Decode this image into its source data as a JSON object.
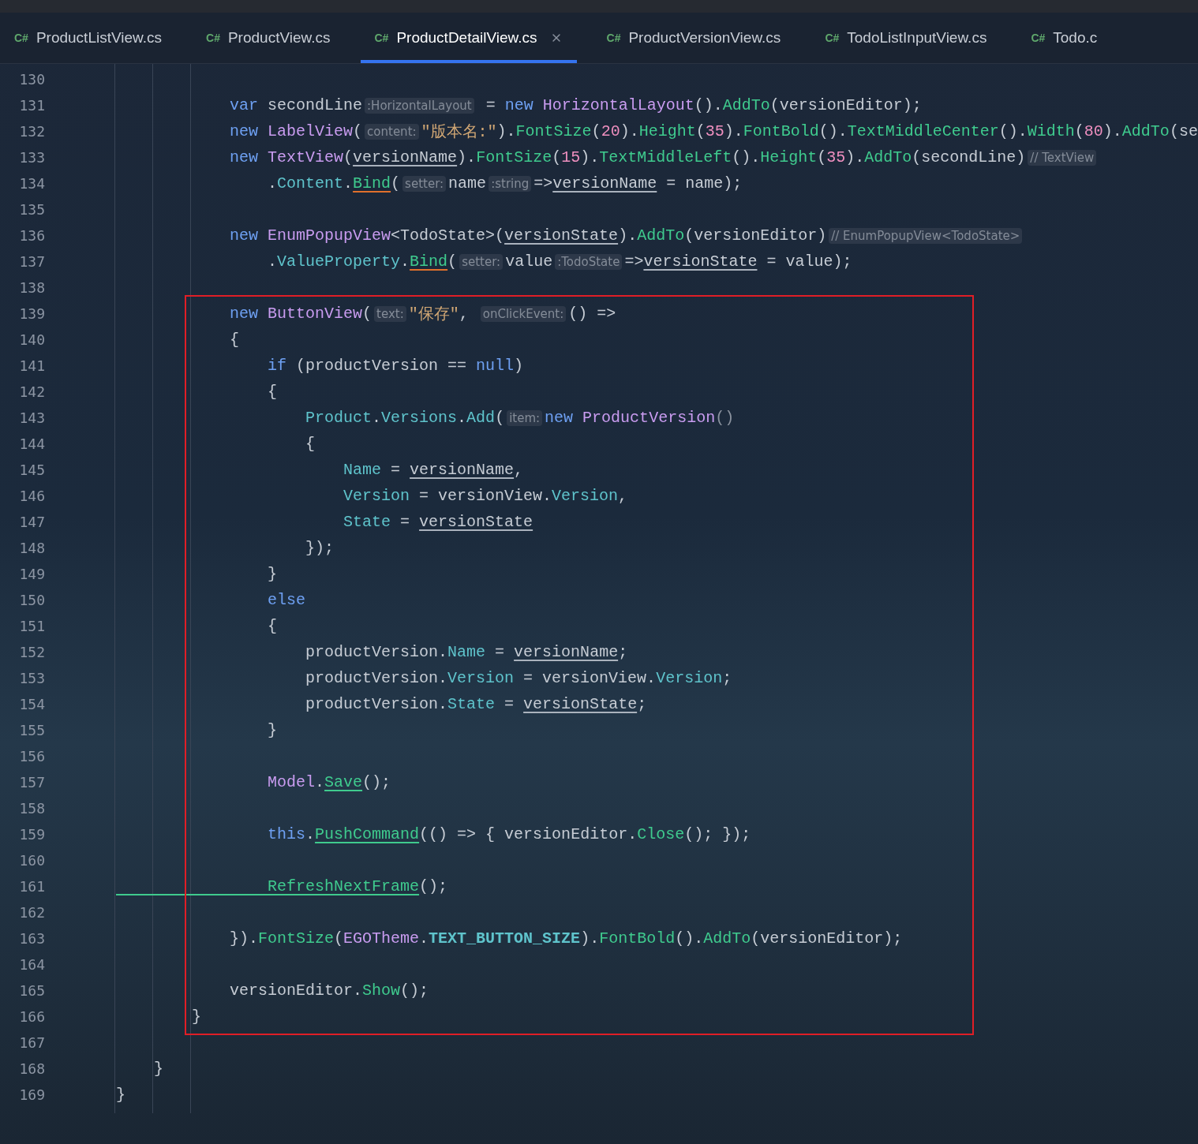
{
  "tabs": [
    {
      "badge": "C#",
      "label": "ProductListView.cs",
      "selected": false
    },
    {
      "badge": "C#",
      "label": "ProductView.cs",
      "selected": false
    },
    {
      "badge": "C#",
      "label": "ProductDetailView.cs",
      "selected": true
    },
    {
      "badge": "C#",
      "label": "ProductVersionView.cs",
      "selected": false
    },
    {
      "badge": "C#",
      "label": "TodoListInputView.cs",
      "selected": false
    },
    {
      "badge": "C#",
      "label": "Todo.c",
      "selected": false
    }
  ],
  "editor": {
    "lines": [
      {
        "n": "130",
        "highlighted": false
      },
      {
        "n": "131",
        "highlighted": false,
        "tokens": [
          {
            "kind": "kw",
            "text": "            var"
          },
          {
            "kind": "plain",
            "text": " secondLine"
          },
          {
            "kind": "hint",
            "text": ":HorizontalLayout"
          },
          {
            "kind": "plain",
            "text": " = "
          },
          {
            "kind": "kw",
            "text": "new"
          },
          {
            "kind": "type",
            "text": " HorizontalLayout"
          },
          {
            "kind": "plain",
            "text": "()."
          },
          {
            "kind": "method",
            "text": "AddTo"
          },
          {
            "kind": "plain",
            "text": "(versionEditor);"
          }
        ]
      },
      {
        "n": "132",
        "highlighted": false,
        "tokens": [
          {
            "kind": "kw",
            "text": "            new"
          },
          {
            "kind": "type",
            "text": " LabelView"
          },
          {
            "kind": "plain",
            "text": "("
          },
          {
            "kind": "hint",
            "text": "content:"
          },
          {
            "kind": "str",
            "text": "\"版本名:\""
          },
          {
            "kind": "plain",
            "text": ")."
          },
          {
            "kind": "method",
            "text": "FontSize"
          },
          {
            "kind": "plain",
            "text": "("
          },
          {
            "kind": "num",
            "text": "20"
          },
          {
            "kind": "plain",
            "text": ")."
          },
          {
            "kind": "method",
            "text": "Height"
          },
          {
            "kind": "plain",
            "text": "("
          },
          {
            "kind": "num",
            "text": "35"
          },
          {
            "kind": "plain",
            "text": ")."
          },
          {
            "kind": "method",
            "text": "FontBold"
          },
          {
            "kind": "plain",
            "text": "()."
          },
          {
            "kind": "method",
            "text": "TextMiddleCenter"
          },
          {
            "kind": "plain",
            "text": "()."
          },
          {
            "kind": "method",
            "text": "Width"
          },
          {
            "kind": "plain",
            "text": "("
          },
          {
            "kind": "num",
            "text": "80"
          },
          {
            "kind": "plain",
            "text": ")."
          },
          {
            "kind": "method",
            "text": "AddTo"
          },
          {
            "kind": "plain",
            "text": "(se"
          }
        ]
      },
      {
        "n": "133",
        "highlighted": false,
        "tokens": [
          {
            "kind": "kw",
            "text": "            new"
          },
          {
            "kind": "type",
            "text": " TextView"
          },
          {
            "kind": "plain",
            "text": "("
          },
          {
            "kind": "ref",
            "text": "versionName"
          },
          {
            "kind": "plain",
            "text": ")."
          },
          {
            "kind": "method",
            "text": "FontSize"
          },
          {
            "kind": "plain",
            "text": "("
          },
          {
            "kind": "num",
            "text": "15"
          },
          {
            "kind": "plain",
            "text": ")."
          },
          {
            "kind": "method",
            "text": "TextMiddleLeft"
          },
          {
            "kind": "plain",
            "text": "()."
          },
          {
            "kind": "method",
            "text": "Height"
          },
          {
            "kind": "plain",
            "text": "("
          },
          {
            "kind": "num",
            "text": "35"
          },
          {
            "kind": "plain",
            "text": ")."
          },
          {
            "kind": "method",
            "text": "AddTo"
          },
          {
            "kind": "plain",
            "text": "(secondLine)"
          },
          {
            "kind": "hint",
            "text": "// TextView"
          }
        ]
      },
      {
        "n": "134",
        "highlighted": false,
        "tokens": [
          {
            "kind": "plain",
            "text": "                ."
          },
          {
            "kind": "prop",
            "text": "Content"
          },
          {
            "kind": "plain",
            "text": "."
          },
          {
            "kind": "bind",
            "text": "Bind"
          },
          {
            "kind": "plain",
            "text": "("
          },
          {
            "kind": "hint",
            "text": "setter:"
          },
          {
            "kind": "plain",
            "text": "name"
          },
          {
            "kind": "hint",
            "text": ":string"
          },
          {
            "kind": "plain",
            "text": "=>"
          },
          {
            "kind": "ref",
            "text": "versionName"
          },
          {
            "kind": "plain",
            "text": " = name);"
          }
        ]
      },
      {
        "n": "135",
        "highlighted": false
      },
      {
        "n": "136",
        "highlighted": false,
        "tokens": [
          {
            "kind": "kw",
            "text": "            new"
          },
          {
            "kind": "type",
            "text": " EnumPopupView"
          },
          {
            "kind": "plain",
            "text": "<TodoState>("
          },
          {
            "kind": "ref",
            "text": "versionState"
          },
          {
            "kind": "plain",
            "text": ")."
          },
          {
            "kind": "method",
            "text": "AddTo"
          },
          {
            "kind": "plain",
            "text": "(versionEditor)"
          },
          {
            "kind": "hint",
            "text": "// EnumPopupView<TodoState>"
          }
        ]
      },
      {
        "n": "137",
        "highlighted": false,
        "tokens": [
          {
            "kind": "plain",
            "text": "                ."
          },
          {
            "kind": "prop",
            "text": "ValueProperty"
          },
          {
            "kind": "plain",
            "text": "."
          },
          {
            "kind": "bind",
            "text": "Bind"
          },
          {
            "kind": "plain",
            "text": "("
          },
          {
            "kind": "hint",
            "text": "setter:"
          },
          {
            "kind": "plain",
            "text": "value"
          },
          {
            "kind": "hint",
            "text": ":TodoState"
          },
          {
            "kind": "plain",
            "text": "=>"
          },
          {
            "kind": "ref",
            "text": "versionState"
          },
          {
            "kind": "plain",
            "text": " = value);"
          }
        ]
      },
      {
        "n": "138",
        "highlighted": false
      },
      {
        "n": "139",
        "highlighted": true,
        "tokens": [
          {
            "kind": "kw",
            "text": "            new"
          },
          {
            "kind": "type",
            "text": " ButtonView"
          },
          {
            "kind": "plain",
            "text": "("
          },
          {
            "kind": "hint",
            "text": "text:"
          },
          {
            "kind": "str",
            "text": "\"保存\""
          },
          {
            "kind": "plain",
            "text": ", "
          },
          {
            "kind": "hint",
            "text": "onClickEvent:"
          },
          {
            "kind": "plain",
            "text": "() =>"
          }
        ]
      },
      {
        "n": "140",
        "highlighted": true,
        "tokens": [
          {
            "kind": "plain",
            "text": "            {"
          }
        ]
      },
      {
        "n": "141",
        "highlighted": true,
        "tokens": [
          {
            "kind": "kw",
            "text": "                if"
          },
          {
            "kind": "plain",
            "text": " (productVersion == "
          },
          {
            "kind": "kw",
            "text": "null"
          },
          {
            "kind": "plain",
            "text": ")"
          }
        ]
      },
      {
        "n": "142",
        "highlighted": true,
        "tokens": [
          {
            "kind": "plain",
            "text": "                {"
          }
        ]
      },
      {
        "n": "143",
        "highlighted": true,
        "tokens": [
          {
            "kind": "prop",
            "text": "                    Product"
          },
          {
            "kind": "plain",
            "text": "."
          },
          {
            "kind": "prop",
            "text": "Versions"
          },
          {
            "kind": "plain",
            "text": "."
          },
          {
            "kind": "prop",
            "text": "Add"
          },
          {
            "kind": "plain",
            "text": "("
          },
          {
            "kind": "hint",
            "text": "item:"
          },
          {
            "kind": "kw",
            "text": "new"
          },
          {
            "kind": "type",
            "text": " ProductVersion"
          },
          {
            "kind": "dim",
            "text": "()"
          }
        ]
      },
      {
        "n": "144",
        "highlighted": true,
        "tokens": [
          {
            "kind": "plain",
            "text": "                    {"
          }
        ]
      },
      {
        "n": "145",
        "highlighted": true,
        "tokens": [
          {
            "kind": "prop",
            "text": "                        Name"
          },
          {
            "kind": "plain",
            "text": " = "
          },
          {
            "kind": "ref",
            "text": "versionName"
          },
          {
            "kind": "plain",
            "text": ","
          }
        ]
      },
      {
        "n": "146",
        "highlighted": true,
        "tokens": [
          {
            "kind": "prop",
            "text": "                        Version"
          },
          {
            "kind": "plain",
            "text": " = versionView."
          },
          {
            "kind": "prop",
            "text": "Version"
          },
          {
            "kind": "plain",
            "text": ","
          }
        ]
      },
      {
        "n": "147",
        "highlighted": true,
        "tokens": [
          {
            "kind": "prop",
            "text": "                        State"
          },
          {
            "kind": "plain",
            "text": " = "
          },
          {
            "kind": "ref",
            "text": "versionState"
          }
        ]
      },
      {
        "n": "148",
        "highlighted": true,
        "tokens": [
          {
            "kind": "plain",
            "text": "                    });"
          }
        ]
      },
      {
        "n": "149",
        "highlighted": true,
        "tokens": [
          {
            "kind": "plain",
            "text": "                }"
          }
        ]
      },
      {
        "n": "150",
        "highlighted": true,
        "tokens": [
          {
            "kind": "kw",
            "text": "                else"
          }
        ]
      },
      {
        "n": "151",
        "highlighted": true,
        "tokens": [
          {
            "kind": "plain",
            "text": "                {"
          }
        ]
      },
      {
        "n": "152",
        "highlighted": true,
        "tokens": [
          {
            "kind": "plain",
            "text": "                    productVersion."
          },
          {
            "kind": "prop",
            "text": "Name"
          },
          {
            "kind": "plain",
            "text": " = "
          },
          {
            "kind": "ref",
            "text": "versionName"
          },
          {
            "kind": "plain",
            "text": ";"
          }
        ]
      },
      {
        "n": "153",
        "highlighted": true,
        "tokens": [
          {
            "kind": "plain",
            "text": "                    productVersion."
          },
          {
            "kind": "prop",
            "text": "Version"
          },
          {
            "kind": "plain",
            "text": " = versionView."
          },
          {
            "kind": "prop",
            "text": "Version"
          },
          {
            "kind": "plain",
            "text": ";"
          }
        ]
      },
      {
        "n": "154",
        "highlighted": true,
        "tokens": [
          {
            "kind": "plain",
            "text": "                    productVersion."
          },
          {
            "kind": "prop",
            "text": "State"
          },
          {
            "kind": "plain",
            "text": " = "
          },
          {
            "kind": "ref",
            "text": "versionState"
          },
          {
            "kind": "plain",
            "text": ";"
          }
        ]
      },
      {
        "n": "155",
        "highlighted": true,
        "tokens": [
          {
            "kind": "plain",
            "text": "                }"
          }
        ]
      },
      {
        "n": "156",
        "highlighted": true
      },
      {
        "n": "157",
        "highlighted": true,
        "tokens": [
          {
            "kind": "type",
            "text": "                Model"
          },
          {
            "kind": "plain",
            "text": "."
          },
          {
            "kind": "refm",
            "text": "Save"
          },
          {
            "kind": "plain",
            "text": "();"
          }
        ]
      },
      {
        "n": "158",
        "highlighted": true
      },
      {
        "n": "159",
        "highlighted": true,
        "tokens": [
          {
            "kind": "kw",
            "text": "                this"
          },
          {
            "kind": "plain",
            "text": "."
          },
          {
            "kind": "refm",
            "text": "PushCommand"
          },
          {
            "kind": "plain",
            "text": "(() => { versionEditor."
          },
          {
            "kind": "method",
            "text": "Close"
          },
          {
            "kind": "plain",
            "text": "(); });"
          }
        ]
      },
      {
        "n": "160",
        "highlighted": true
      },
      {
        "n": "161",
        "highlighted": true,
        "tokens": [
          {
            "kind": "refm",
            "text": "                RefreshNextFrame"
          },
          {
            "kind": "plain",
            "text": "();"
          }
        ]
      },
      {
        "n": "162",
        "highlighted": true
      },
      {
        "n": "163",
        "highlighted": true,
        "tokens": [
          {
            "kind": "plain",
            "text": "            })."
          },
          {
            "kind": "method",
            "text": "FontSize"
          },
          {
            "kind": "plain",
            "text": "("
          },
          {
            "kind": "type",
            "text": "EGOTheme"
          },
          {
            "kind": "plain",
            "text": "."
          },
          {
            "kind": "const",
            "text": "TEXT_BUTTON_SIZE"
          },
          {
            "kind": "plain",
            "text": ")."
          },
          {
            "kind": "method",
            "text": "FontBold"
          },
          {
            "kind": "plain",
            "text": "()."
          },
          {
            "kind": "method",
            "text": "AddTo"
          },
          {
            "kind": "plain",
            "text": "(versionEditor);"
          }
        ]
      },
      {
        "n": "164",
        "highlighted": true
      },
      {
        "n": "165",
        "highlighted": true,
        "tokens": [
          {
            "kind": "plain",
            "text": "            versionEditor."
          },
          {
            "kind": "method",
            "text": "Show"
          },
          {
            "kind": "plain",
            "text": "();"
          }
        ]
      },
      {
        "n": "166",
        "highlighted": true,
        "tokens": [
          {
            "kind": "plain",
            "text": "        }"
          }
        ]
      },
      {
        "n": "167",
        "highlighted": false
      },
      {
        "n": "168",
        "highlighted": false,
        "tokens": [
          {
            "kind": "plain",
            "text": "    }"
          }
        ]
      },
      {
        "n": "169",
        "highlighted": false,
        "tokens": [
          {
            "kind": "plain",
            "text": "}"
          }
        ]
      }
    ]
  }
}
